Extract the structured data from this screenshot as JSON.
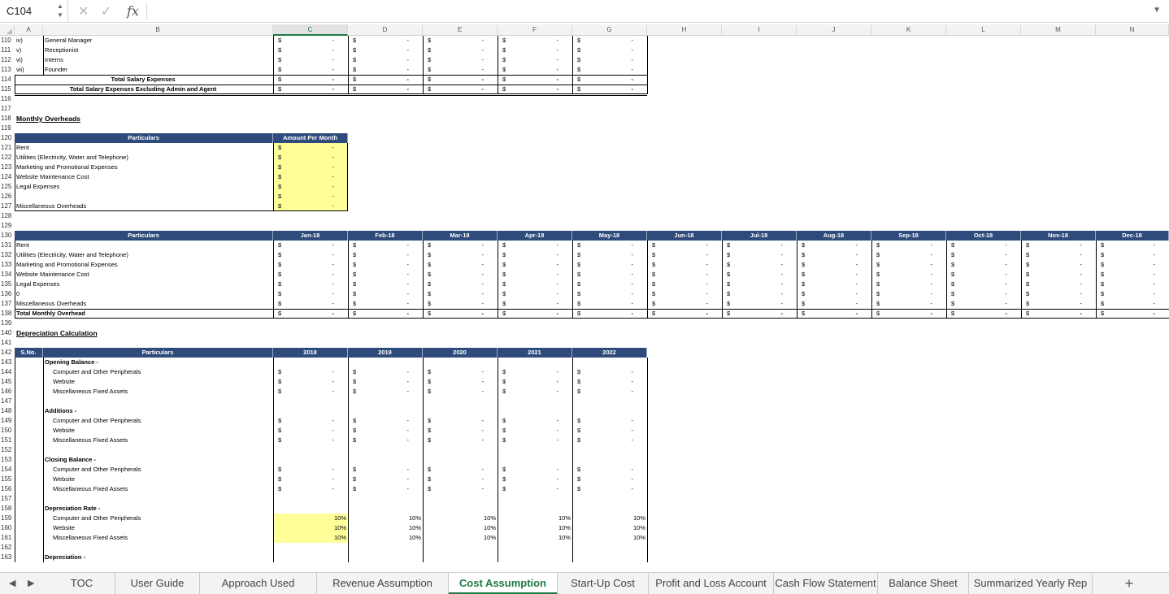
{
  "formula_bar": {
    "cell_ref": "C104",
    "formula": ""
  },
  "columns": [
    "A",
    "B",
    "C",
    "D",
    "E",
    "F",
    "G",
    "H",
    "I",
    "J",
    "K",
    "L",
    "M",
    "N"
  ],
  "selected_column": "C",
  "salary_rows": [
    {
      "row": "110",
      "idx": "iv)",
      "label": "General Manager"
    },
    {
      "row": "111",
      "idx": "v)",
      "label": "Receptionist"
    },
    {
      "row": "112",
      "idx": "vi)",
      "label": "Interns"
    },
    {
      "row": "113",
      "idx": "vii)",
      "label": "Founder"
    }
  ],
  "salary_totals": [
    {
      "row": "114",
      "label": "Total Salary Expenses"
    },
    {
      "row": "115",
      "label": "Total Salary Expenses Excluding Admin and Agent"
    }
  ],
  "currency": "$",
  "dash": "-",
  "monthly_overheads": {
    "title": "Monthly Overheads",
    "header_particulars": "Particulars",
    "header_amount": "Amount Per Month",
    "items": [
      {
        "row": "121",
        "label": "Rent"
      },
      {
        "row": "122",
        "label": "Utilities (Electricity, Water and Telephone)"
      },
      {
        "row": "123",
        "label": "Marketing and Promotional Expenses"
      },
      {
        "row": "124",
        "label": "Website Maintenance Cost"
      },
      {
        "row": "125",
        "label": "Legal Expenses"
      },
      {
        "row": "126",
        "label": ""
      },
      {
        "row": "127",
        "label": "Miscellaneous Overheads"
      }
    ]
  },
  "monthly_table": {
    "header_particulars": "Particulars",
    "months": [
      "Jan-18",
      "Feb-18",
      "Mar-18",
      "Apr-18",
      "May-18",
      "Jun-18",
      "Jul-18",
      "Aug-18",
      "Sep-18",
      "Oct-18",
      "Nov-18",
      "Dec-18"
    ],
    "items": [
      {
        "row": "131",
        "label": "Rent"
      },
      {
        "row": "132",
        "label": "Utilities (Electricity, Water and Telephone)"
      },
      {
        "row": "133",
        "label": "Marketing and Promotional Expenses"
      },
      {
        "row": "134",
        "label": "Website Maintenance Cost"
      },
      {
        "row": "135",
        "label": "Legal Expenses"
      },
      {
        "row": "136",
        "label": "0"
      },
      {
        "row": "137",
        "label": "Miscellaneous Overheads"
      }
    ],
    "total": {
      "row": "138",
      "label": "Total Monthly Overhead"
    }
  },
  "depreciation": {
    "title": "Depreciation Calculation",
    "header_sno": "S.No.",
    "header_particulars": "Particulars",
    "years": [
      "2018",
      "2019",
      "2020",
      "2021",
      "2022"
    ],
    "sections": [
      {
        "title_row": "143",
        "title": "Opening Balance -",
        "rows": [
          {
            "row": "144",
            "label": "Computer and Other Peripherals"
          },
          {
            "row": "145",
            "label": "Website"
          },
          {
            "row": "146",
            "label": "Miscellaneous Fixed Assets"
          }
        ],
        "blank": "147"
      },
      {
        "title_row": "148",
        "title": "Additions -",
        "rows": [
          {
            "row": "149",
            "label": "Computer and Other Peripherals"
          },
          {
            "row": "150",
            "label": "Website"
          },
          {
            "row": "151",
            "label": "Miscellaneous Fixed Assets"
          }
        ],
        "blank": "152"
      },
      {
        "title_row": "153",
        "title": "Closing Balance -",
        "rows": [
          {
            "row": "154",
            "label": "Computer and Other Peripherals"
          },
          {
            "row": "155",
            "label": "Website"
          },
          {
            "row": "156",
            "label": "Miscellaneous Fixed Assets"
          }
        ],
        "blank": "157"
      }
    ],
    "rate_section": {
      "title_row": "158",
      "title": "Depreciation Rate -",
      "rows": [
        {
          "row": "159",
          "label": "Computer and Other Peripherals",
          "rate": "10%"
        },
        {
          "row": "160",
          "label": "Website",
          "rate": "10%"
        },
        {
          "row": "161",
          "label": "Miscellaneous Fixed Assets",
          "rate": "10%"
        }
      ],
      "blank": "162"
    },
    "dep_title_row": "163",
    "dep_title": "Depreciation -"
  },
  "blank_rows": [
    "116",
    "117",
    "119",
    "128",
    "129",
    "139",
    "141"
  ],
  "sheet_tabs": [
    "TOC",
    "User Guide",
    "Approach Used",
    "Revenue Assumption",
    "Cost Assumption",
    "Start-Up Cost",
    "Profit and Loss Account",
    "Cash Flow Statement",
    "Balance Sheet",
    "Summarized Yearly Rep"
  ],
  "active_tab": "Cost Assumption",
  "colors": {
    "header_band": "#2e4b7b",
    "input_highlight": "#ffff9a",
    "active_tab": "#1d7a44"
  }
}
